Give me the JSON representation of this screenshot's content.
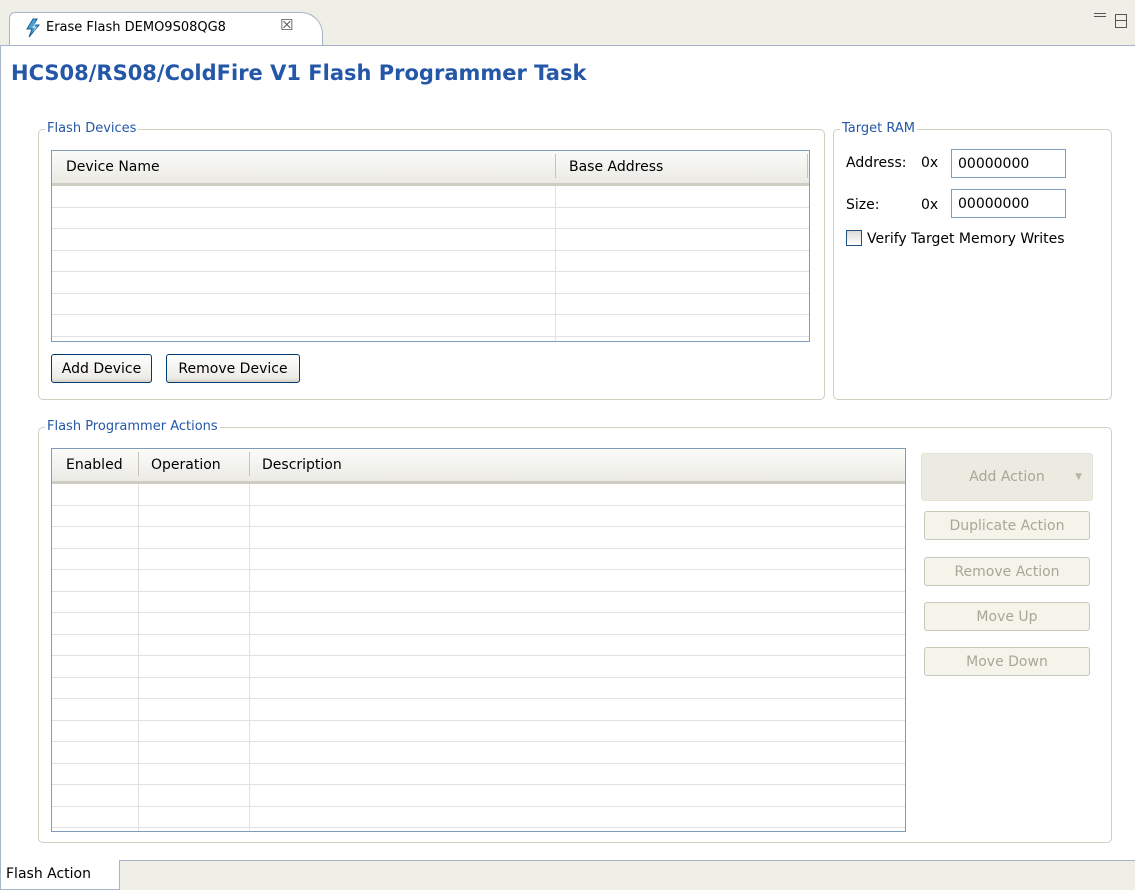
{
  "editor": {
    "tab_title": "Erase Flash DEMO9S08QG8",
    "tab_close": "☒",
    "page_title": "HCS08/RS08/ColdFire V1 Flash Programmer Task"
  },
  "flash_devices": {
    "legend": "Flash Devices",
    "columns": [
      "Device Name",
      "Base Address"
    ],
    "rows": [],
    "add_button": "Add Device",
    "remove_button": "Remove Device"
  },
  "target_ram": {
    "legend": "Target RAM",
    "address_label": "Address:",
    "address_prefix": "0x",
    "address_value": "00000000",
    "size_label": "Size:",
    "size_prefix": "0x",
    "size_value": "00000000",
    "verify_label": "Verify Target Memory Writes",
    "verify_checked": false
  },
  "actions": {
    "legend": "Flash Programmer Actions",
    "columns": [
      "Enabled",
      "Operation",
      "Description"
    ],
    "rows": [],
    "buttons": {
      "add": "Add Action",
      "duplicate": "Duplicate Action",
      "remove": "Remove Action",
      "move_up": "Move Up",
      "move_down": "Move Down"
    }
  },
  "bottom_tabs": {
    "active": "Flash Action"
  },
  "colors": {
    "title_blue": "#2457a7",
    "border_blue": "#7f9db9",
    "tab_bg": "#f0efe7"
  }
}
